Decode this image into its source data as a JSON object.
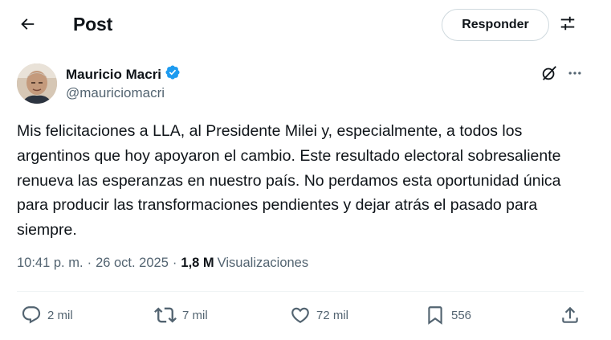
{
  "header": {
    "back_icon": "arrow-left-icon",
    "title": "Post",
    "reply_label": "Responder",
    "settings_icon": "sliders-icon"
  },
  "author": {
    "name": "Mauricio Macri",
    "handle": "@mauriciomacri",
    "verified": true,
    "verified_color": "#1d9bf0"
  },
  "post": {
    "text": "Mis felicitaciones a LLA, al Presidente Milei y, especialmente, a todos los argentinos que hoy apoyaron el cambio. Este resultado electoral sobresaliente renueva las esperanzas en nuestro país. No perdamos esta oportunidad única para producir las transformaciones pendientes y dejar atrás el pasado para siempre.",
    "time": "10:41 p. m.",
    "date": "26 oct. 2025",
    "views_count": "1,8 M",
    "views_label": "Visualizaciones"
  },
  "actions": {
    "replies": "2 mil",
    "reposts": "7 mil",
    "likes": "72 mil",
    "bookmarks": "556"
  },
  "colors": {
    "text_primary": "#0f1419",
    "text_secondary": "#536471",
    "border": "#cfd9de",
    "accent": "#1d9bf0"
  }
}
